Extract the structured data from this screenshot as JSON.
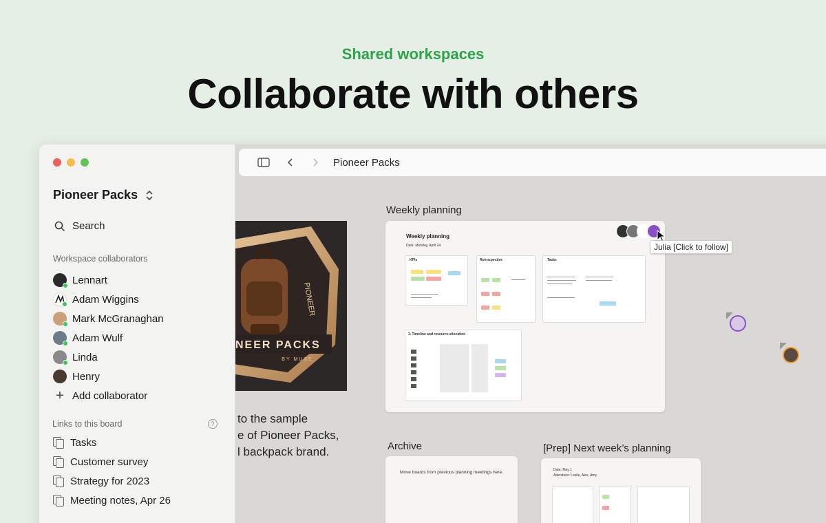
{
  "hero": {
    "eyebrow": "Shared workspaces",
    "title": "Collaborate with others"
  },
  "sidebar": {
    "workspace_title": "Pioneer Packs",
    "search_label": "Search",
    "collaborators_label": "Workspace collaborators",
    "collaborators": [
      {
        "name": "Lennart",
        "avatar_color": "#2a2a2a"
      },
      {
        "name": "Adam Wiggins",
        "avatar_color": "#ffffff"
      },
      {
        "name": "Mark McGranaghan",
        "avatar_color": "#c9a07a"
      },
      {
        "name": "Adam Wulf",
        "avatar_color": "#6d7a89"
      },
      {
        "name": "Linda",
        "avatar_color": "#8a8a8a"
      },
      {
        "name": "Henry",
        "avatar_color": "#4a3a30"
      }
    ],
    "add_collaborator": "Add collaborator",
    "links_label": "Links to this board",
    "links": [
      "Tasks",
      "Customer survey",
      "Strategy for 2023",
      "Meeting notes, Apr 26"
    ]
  },
  "toolbar": {
    "title": "Pioneer Packs"
  },
  "canvas": {
    "image_card": {
      "title_text": "NEER PACKS",
      "subtitle_text": "BY MUSE"
    },
    "welcome_lines": [
      "to the sample",
      "e of Pioneer Packs,",
      "l backpack brand."
    ],
    "weekly": {
      "label": "Weekly planning",
      "inner_title": "Weekly planning",
      "inner_date": "Date: Monday, April 24",
      "kpis": "KPIs",
      "retro": "Retrospective",
      "tasks": "Tasks",
      "timeline": "3. Timeline and resource allocation"
    },
    "tooltip": "Julia [Click to follow]",
    "archive": {
      "label": "Archive",
      "body": "Move boards from previous planning meetings here."
    },
    "prep": {
      "label": "[Prep] Next week’s planning",
      "date": "Date: May 1",
      "attendees": "Attendees: Leslie, Alex, Amy"
    }
  },
  "colors": {
    "accent_green": "#2fa34a",
    "online": "#35c759",
    "cursor_purple": "#8a4fc7",
    "cursor_orange": "#f0a030"
  }
}
